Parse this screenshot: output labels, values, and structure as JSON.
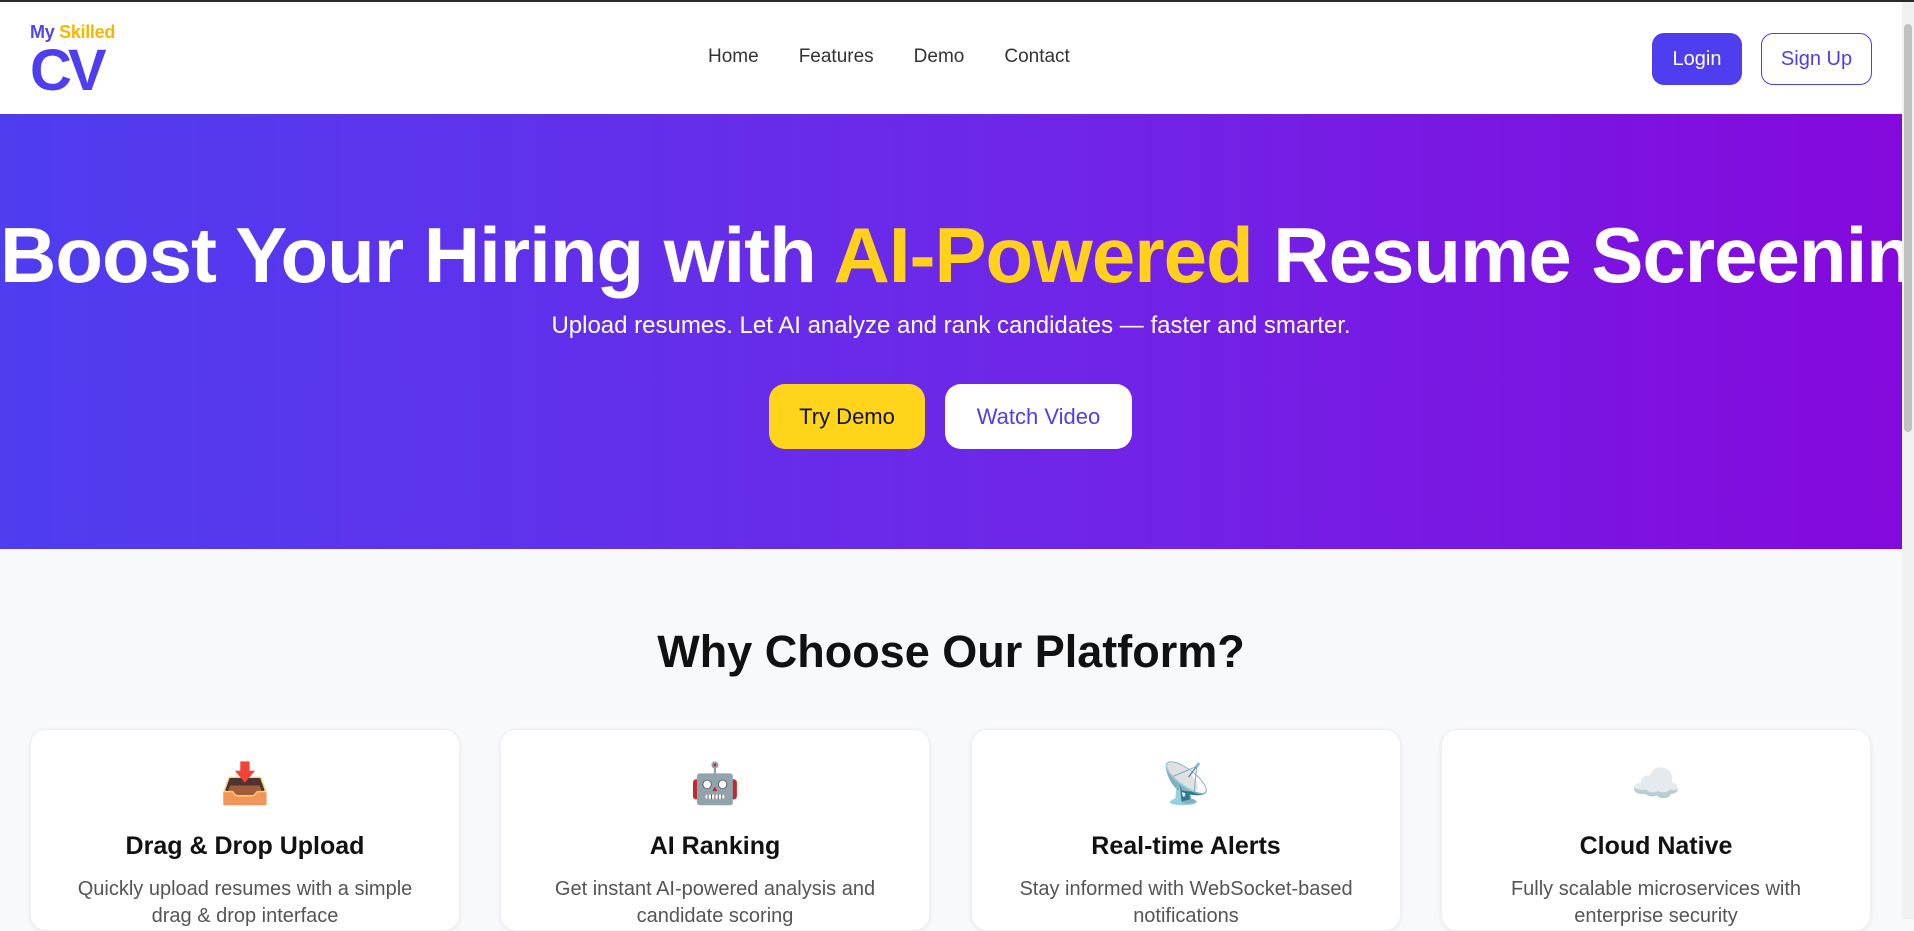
{
  "brand": {
    "my": "My",
    "skilled": "Skilled",
    "cv": "CV"
  },
  "nav": {
    "items": [
      "Home",
      "Features",
      "Demo",
      "Contact"
    ]
  },
  "auth": {
    "login": "Login",
    "signup": "Sign Up"
  },
  "hero": {
    "title_pre": "Boost Your Hiring with ",
    "title_highlight": "AI-Powered",
    "title_post": " Resume Screening",
    "subtitle": "Upload resumes. Let AI analyze and rank candidates — faster and smarter.",
    "try_demo": "Try Demo",
    "watch_video": "Watch Video"
  },
  "features": {
    "heading": "Why Choose Our Platform?",
    "cards": [
      {
        "icon": "📥",
        "icon_name": "inbox-tray-icon",
        "title": "Drag & Drop Upload",
        "desc": "Quickly upload resumes with a simple drag & drop interface"
      },
      {
        "icon": "🤖",
        "icon_name": "robot-icon",
        "title": "AI Ranking",
        "desc": "Get instant AI-powered analysis and candidate scoring"
      },
      {
        "icon": "📡",
        "icon_name": "satellite-antenna-icon",
        "title": "Real-time Alerts",
        "desc": "Stay informed with WebSocket-based notifications"
      },
      {
        "icon": "☁️",
        "icon_name": "cloud-icon",
        "title": "Cloud Native",
        "desc": "Fully scalable microservices with enterprise security"
      }
    ]
  },
  "colors": {
    "brand": "#4f3df0",
    "accent": "#ffd11a",
    "hero_end": "#8409dc"
  }
}
